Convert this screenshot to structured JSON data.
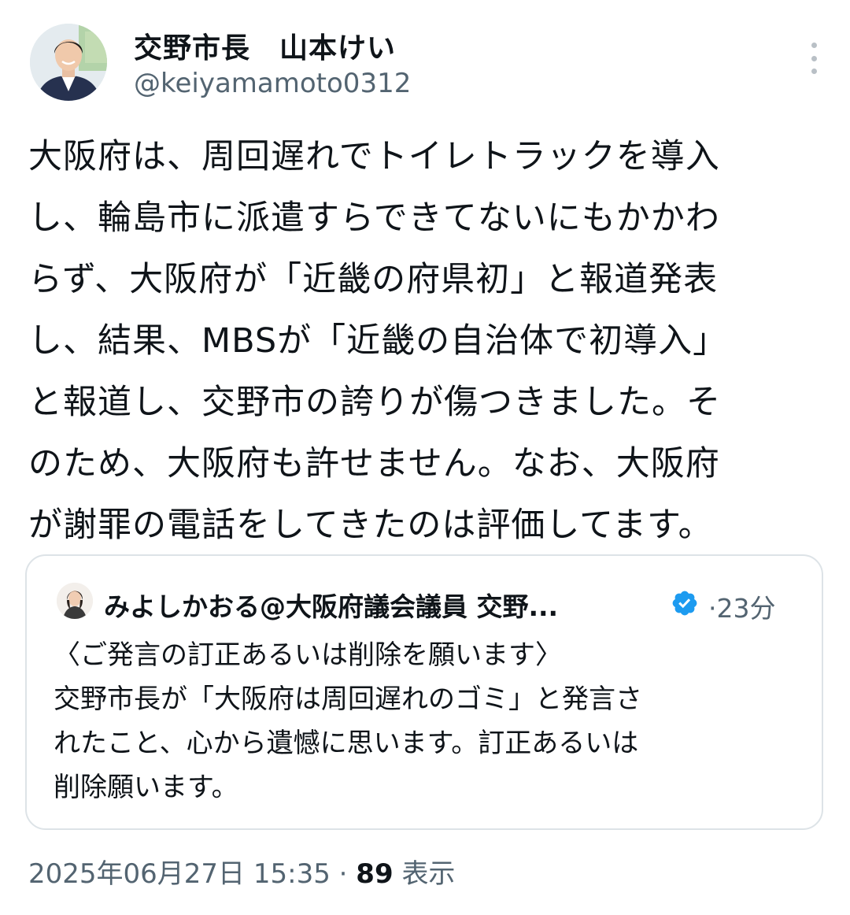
{
  "author": {
    "name": "交野市長　山本けい",
    "handle": "@keiyamamoto0312"
  },
  "tweet": {
    "lines": [
      "大阪府は、周回遅れでトイレトラックを導入",
      "し、輪島市に派遣すらできてないにもかかわ",
      "らず、大阪府が「近畿の府県初」と報道発表",
      "し、結果、MBSが「近畿の自治体で初導入」",
      "と報道し、交野市の誇りが傷つきました。そ",
      "のため、大阪府も許せません。なお、大阪府",
      "が謝罪の電話をしてきたのは評価してます。"
    ]
  },
  "quote": {
    "name": "みよしかおる@大阪府議会議員 交野...",
    "separator": "·",
    "time": "23分",
    "lines": [
      "〈ご発言の訂正あるいは削除を願います〉",
      "交野市長が「大阪府は周回遅れのゴミ」と発言さ",
      "れたこと、心から遺憾に思います。訂正あるいは",
      "削除願います。"
    ]
  },
  "meta": {
    "timestamp": "2025年06月27日 15:35",
    "separator": "·",
    "views": "89",
    "views_label": "表示"
  },
  "colors": {
    "text": "#0f1419",
    "secondary": "#536471",
    "verified": "#1d9bf0",
    "border": "#dde3e7"
  },
  "icons": {
    "more": "more-vertical-icon",
    "verified": "verified-badge-icon"
  }
}
